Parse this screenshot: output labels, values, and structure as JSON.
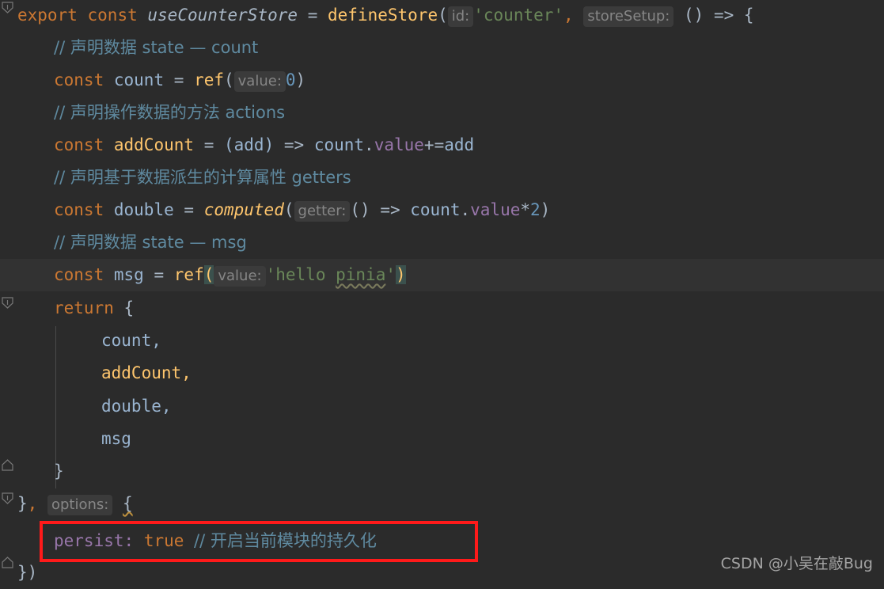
{
  "editor": {
    "theme_name": "darcula",
    "background": "#2b2b2b",
    "current_line_background": "#323232",
    "default_text_color": "#a9b7c6",
    "language": "javascript",
    "colors": {
      "keyword": "#cc7832",
      "function": "#ffc66d",
      "local_variable": "#9ab5d1",
      "field": "#9876aa",
      "number": "#6897bb",
      "string": "#6a8759",
      "comment": "#5f8aa0",
      "inlay_hint_text": "#868686",
      "inlay_hint_background": "#3b3b3b",
      "matched_bracket_background": "#3b514d",
      "annotation_red": "#ff1a1a"
    }
  },
  "code": {
    "line1": {
      "export": "export",
      "const": "const",
      "store_name": "useCounterStore",
      "equals": "=",
      "define_store": "defineStore",
      "open_paren": "(",
      "hint_id": "id:",
      "id_value": "'counter'",
      "comma": ",",
      "hint_store_setup": "storeSetup:",
      "arrow_params": "()",
      "arrow": "=>",
      "open_brace": "{"
    },
    "line2_comment": "// 声明数据 state — count",
    "line3": {
      "const": "const",
      "name": "count",
      "equals": "=",
      "ref": "ref",
      "open_paren": "(",
      "hint_value": "value:",
      "value": "0",
      "close_paren": ")"
    },
    "line4_comment": "// 声明操作数据的方法 actions",
    "line5": {
      "const": "const",
      "name": "addCount",
      "equals": "=",
      "params": "(add)",
      "arrow": "=>",
      "object": "count",
      "dot": ".",
      "field": "value",
      "operator": "+=",
      "argument": "add"
    },
    "line6_comment": "// 声明基于数据派生的计算属性 getters",
    "line7": {
      "const": "const",
      "name": "double",
      "equals": "=",
      "computed": "computed",
      "open_paren": "(",
      "hint_getter": "getter:",
      "arrow_params": "()",
      "arrow": "=>",
      "object": "count",
      "dot": ".",
      "field": "value",
      "operator": "*",
      "number": "2",
      "close_paren": ")"
    },
    "line8_comment": "// 声明数据 state — msg",
    "line9": {
      "const": "const",
      "name": "msg",
      "equals": "=",
      "ref": "ref",
      "open_paren": "(",
      "hint_value": "value:",
      "string_open": "'hello ",
      "string_squiggle": "pinia",
      "string_close": "'",
      "close_paren": ")"
    },
    "line10": {
      "return": "return",
      "open_brace": "{"
    },
    "line11": "count,",
    "line12": "addCount,",
    "line13": "double,",
    "line14": "msg",
    "line15_close_brace": "}",
    "line16": {
      "close_brace": "}",
      "comma": ",",
      "hint_options": "options:",
      "open_brace": "{"
    },
    "line17_highlighted": {
      "key": "persist:",
      "value": "true",
      "comment": "// 开启当前模块的持久化"
    },
    "line18": "})"
  },
  "annotation": {
    "type": "red-rectangle-highlight",
    "target": "persist-option-line"
  },
  "watermark": {
    "text": "CSDN @小吴在敲Bug"
  }
}
